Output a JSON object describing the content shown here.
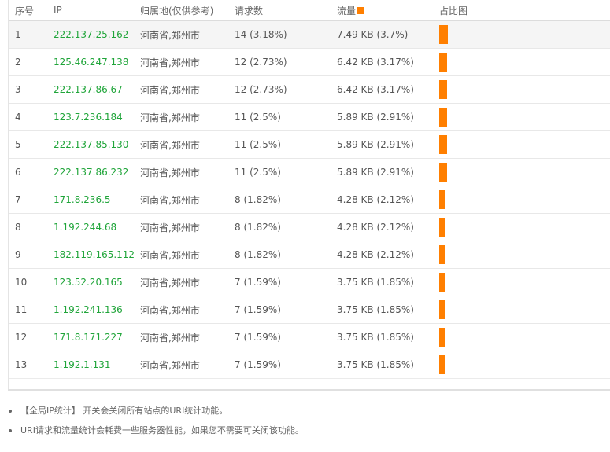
{
  "table": {
    "headers": {
      "index": "序号",
      "ip": "IP",
      "location": "归属地(仅供参考)",
      "requests": "请求数",
      "traffic": "流量",
      "chart": "占比图"
    },
    "sort_icon": "orange-square-sort-icon",
    "accent_color": "#ff7f00",
    "ip_color": "#20a53a",
    "rows": [
      {
        "index": "1",
        "ip": "222.137.25.162",
        "location": "河南省,郑州市",
        "requests": "14 (3.18%)",
        "traffic": "7.49 KB (3.7%)",
        "share_percent": 3.7
      },
      {
        "index": "2",
        "ip": "125.46.247.138",
        "location": "河南省,郑州市",
        "requests": "12 (2.73%)",
        "traffic": "6.42 KB (3.17%)",
        "share_percent": 3.17
      },
      {
        "index": "3",
        "ip": "222.137.86.67",
        "location": "河南省,郑州市",
        "requests": "12 (2.73%)",
        "traffic": "6.42 KB (3.17%)",
        "share_percent": 3.17
      },
      {
        "index": "4",
        "ip": "123.7.236.184",
        "location": "河南省,郑州市",
        "requests": "11 (2.5%)",
        "traffic": "5.89 KB (2.91%)",
        "share_percent": 2.91
      },
      {
        "index": "5",
        "ip": "222.137.85.130",
        "location": "河南省,郑州市",
        "requests": "11 (2.5%)",
        "traffic": "5.89 KB (2.91%)",
        "share_percent": 2.91
      },
      {
        "index": "6",
        "ip": "222.137.86.232",
        "location": "河南省,郑州市",
        "requests": "11 (2.5%)",
        "traffic": "5.89 KB (2.91%)",
        "share_percent": 2.91
      },
      {
        "index": "7",
        "ip": "171.8.236.5",
        "location": "河南省,郑州市",
        "requests": "8 (1.82%)",
        "traffic": "4.28 KB (2.12%)",
        "share_percent": 2.12
      },
      {
        "index": "8",
        "ip": "1.192.244.68",
        "location": "河南省,郑州市",
        "requests": "8 (1.82%)",
        "traffic": "4.28 KB (2.12%)",
        "share_percent": 2.12
      },
      {
        "index": "9",
        "ip": "182.119.165.112",
        "location": "河南省,郑州市",
        "requests": "8 (1.82%)",
        "traffic": "4.28 KB (2.12%)",
        "share_percent": 2.12
      },
      {
        "index": "10",
        "ip": "123.52.20.165",
        "location": "河南省,郑州市",
        "requests": "7 (1.59%)",
        "traffic": "3.75 KB (1.85%)",
        "share_percent": 1.85
      },
      {
        "index": "11",
        "ip": "1.192.241.136",
        "location": "河南省,郑州市",
        "requests": "7 (1.59%)",
        "traffic": "3.75 KB (1.85%)",
        "share_percent": 1.85
      },
      {
        "index": "12",
        "ip": "171.8.171.227",
        "location": "河南省,郑州市",
        "requests": "7 (1.59%)",
        "traffic": "3.75 KB (1.85%)",
        "share_percent": 1.85
      },
      {
        "index": "13",
        "ip": "1.192.1.131",
        "location": "河南省,郑州市",
        "requests": "7 (1.59%)",
        "traffic": "3.75 KB (1.85%)",
        "share_percent": 1.85
      }
    ]
  },
  "notes": [
    "【全局IP统计】 开关会关闭所有站点的URI统计功能。",
    "URI请求和流量统计会耗费一些服务器性能，如果您不需要可关闭该功能。"
  ]
}
